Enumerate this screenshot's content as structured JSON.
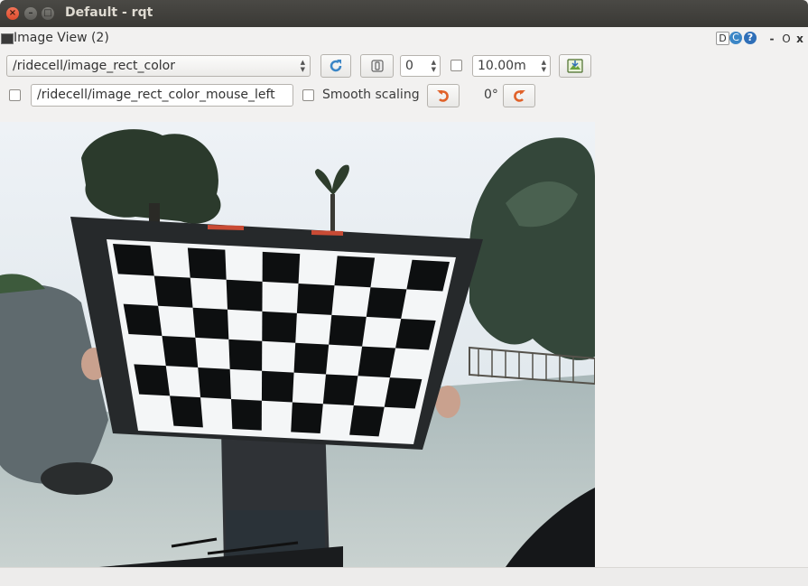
{
  "window": {
    "title": "Default - rqt",
    "close_glyph": "×",
    "min_glyph": "–",
    "max_glyph": "□"
  },
  "plugin": {
    "title": "Image View (2)",
    "help_label": "D",
    "reload_label": "C",
    "question_label": "?",
    "minimize_label": "-",
    "float_label": "O",
    "close_label": "x"
  },
  "toolbar": {
    "topic": "/ridecell/image_rect_color",
    "number_value": "0",
    "max_range": "10.00m",
    "mouse_topic": "/ridecell/image_rect_color_mouse_left",
    "smooth_scaling_label": "Smooth scaling",
    "rotation": "0°"
  },
  "icons": {
    "refresh": "refresh-icon",
    "zoom": "zoom-icon",
    "save": "save-image-icon",
    "rotate_left": "rotate-left-icon",
    "rotate_right": "rotate-right-icon"
  },
  "colors": {
    "accent_blue": "#3b86c6",
    "rotate_orange": "#e0622a"
  }
}
